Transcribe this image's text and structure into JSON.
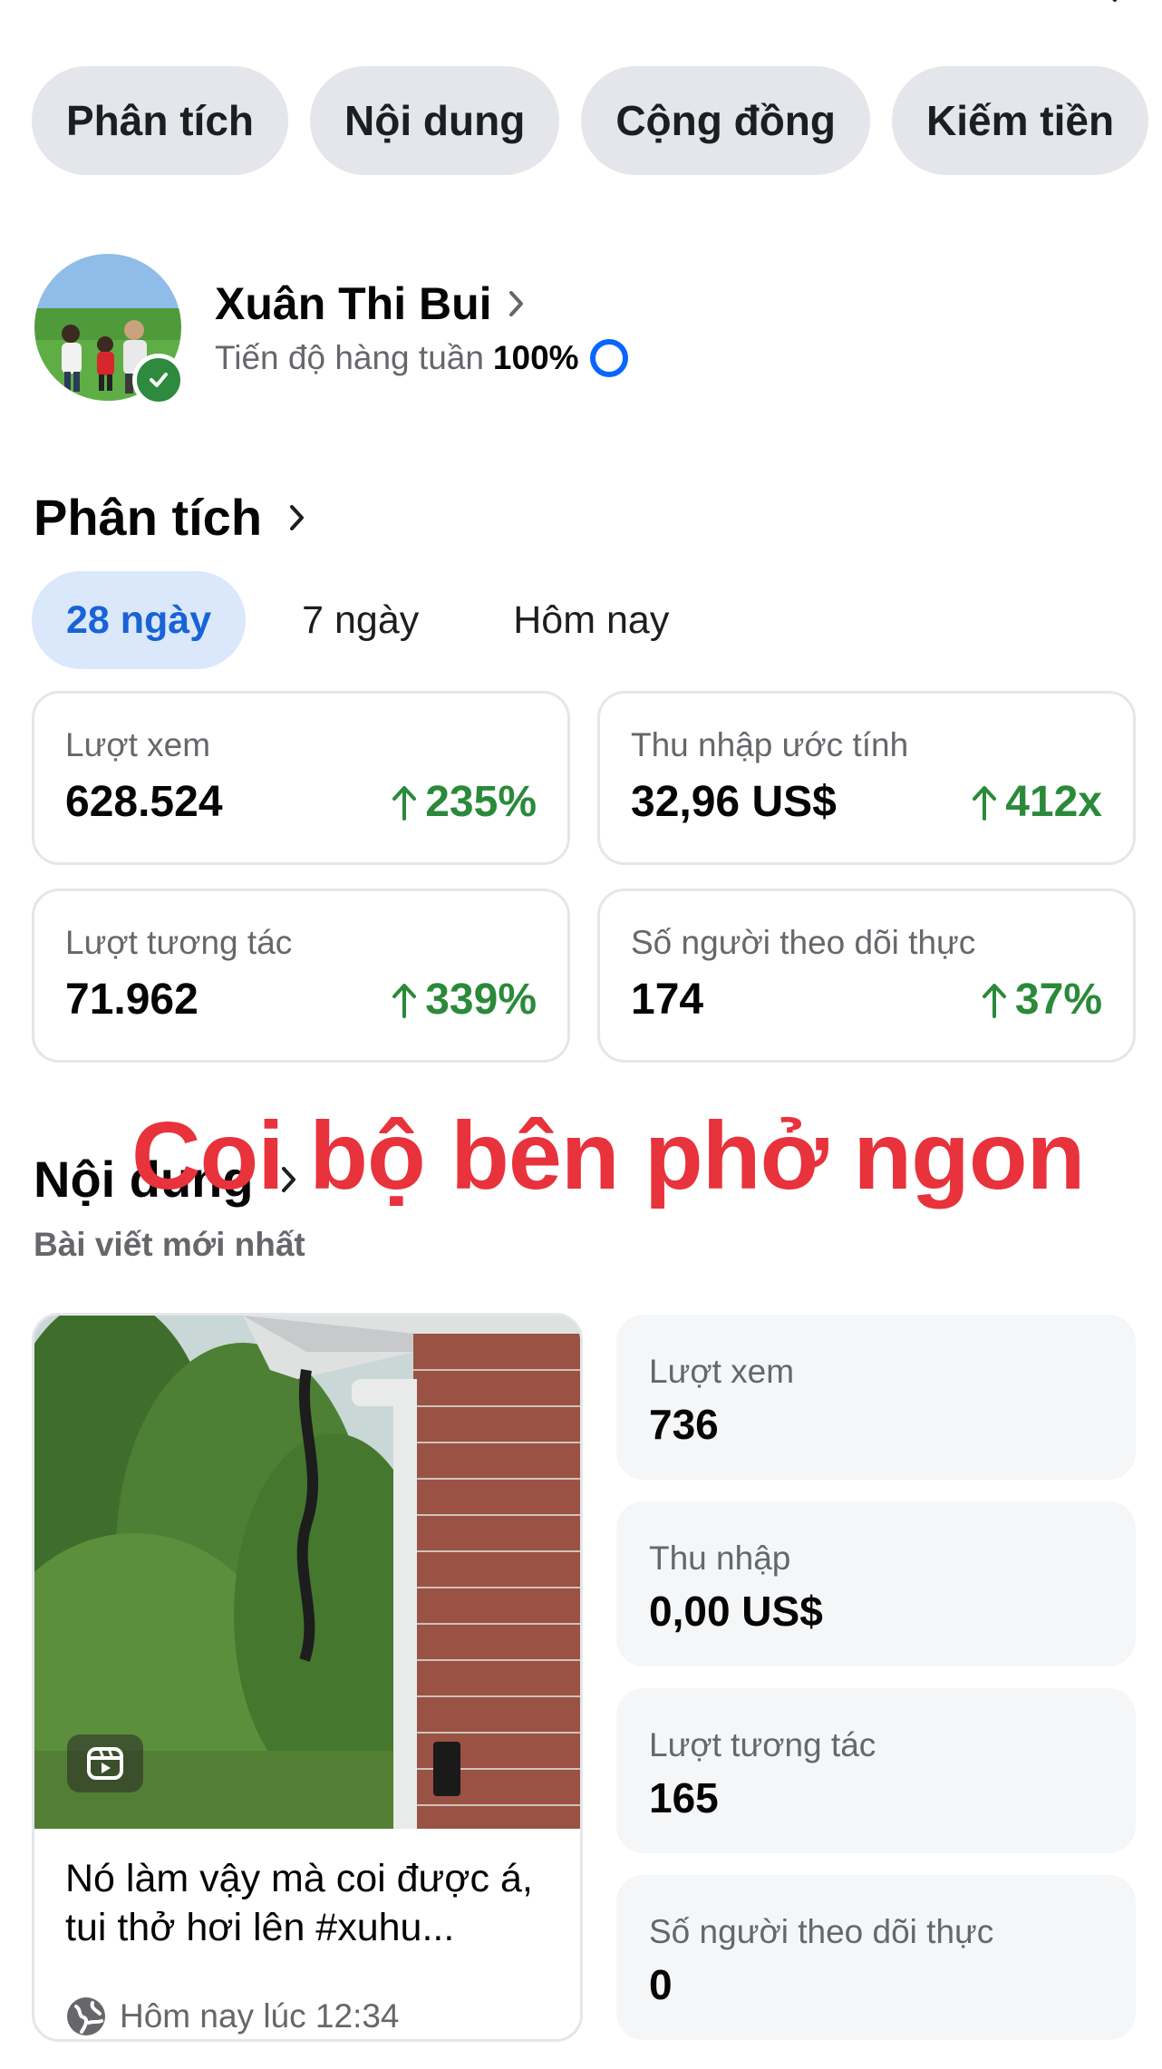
{
  "tabs": [
    {
      "label": "Phân tích"
    },
    {
      "label": "Nội dung"
    },
    {
      "label": "Cộng đồng"
    },
    {
      "label": "Kiếm tiền"
    }
  ],
  "profile": {
    "name": "Xuân Thi Bui",
    "progress_label": "Tiến độ hàng tuần",
    "progress_value": "100%"
  },
  "analytics": {
    "title": "Phân tích",
    "periods": [
      {
        "label": "28 ngày",
        "active": true
      },
      {
        "label": "7 ngày",
        "active": false
      },
      {
        "label": "Hôm nay",
        "active": false
      }
    ],
    "stats": [
      {
        "label": "Lượt xem",
        "value": "628.524",
        "change": "235%"
      },
      {
        "label": "Thu nhập ước tính",
        "value": "32,96 US$",
        "change": "412x"
      },
      {
        "label": "Lượt tương tác",
        "value": "71.962",
        "change": "339%"
      },
      {
        "label": "Số người theo dõi thực",
        "value": "174",
        "change": "37%"
      }
    ],
    "positive_color": "#2a8a3a"
  },
  "content": {
    "title": "Nội dung",
    "subtitle": "Bài viết mới nhất",
    "overlay_caption": "Coi bộ bên phở ngon",
    "post": {
      "title": "Nó làm vậy mà coi được á, tui thở hơi lên  #xuhu...",
      "meta": "Hôm nay lúc 12:34"
    },
    "metrics": [
      {
        "label": "Lượt xem",
        "value": "736"
      },
      {
        "label": "Thu nhập",
        "value": "0,00 US$"
      },
      {
        "label": "Lượt tương tác",
        "value": "165"
      },
      {
        "label": "Số người theo dõi thực",
        "value": "0"
      }
    ]
  },
  "colors": {
    "accent": "#0866ff",
    "active_tab_bg": "#dbe8fb",
    "active_tab_text": "#1863d6",
    "overlay_caption": "#e8323c"
  }
}
